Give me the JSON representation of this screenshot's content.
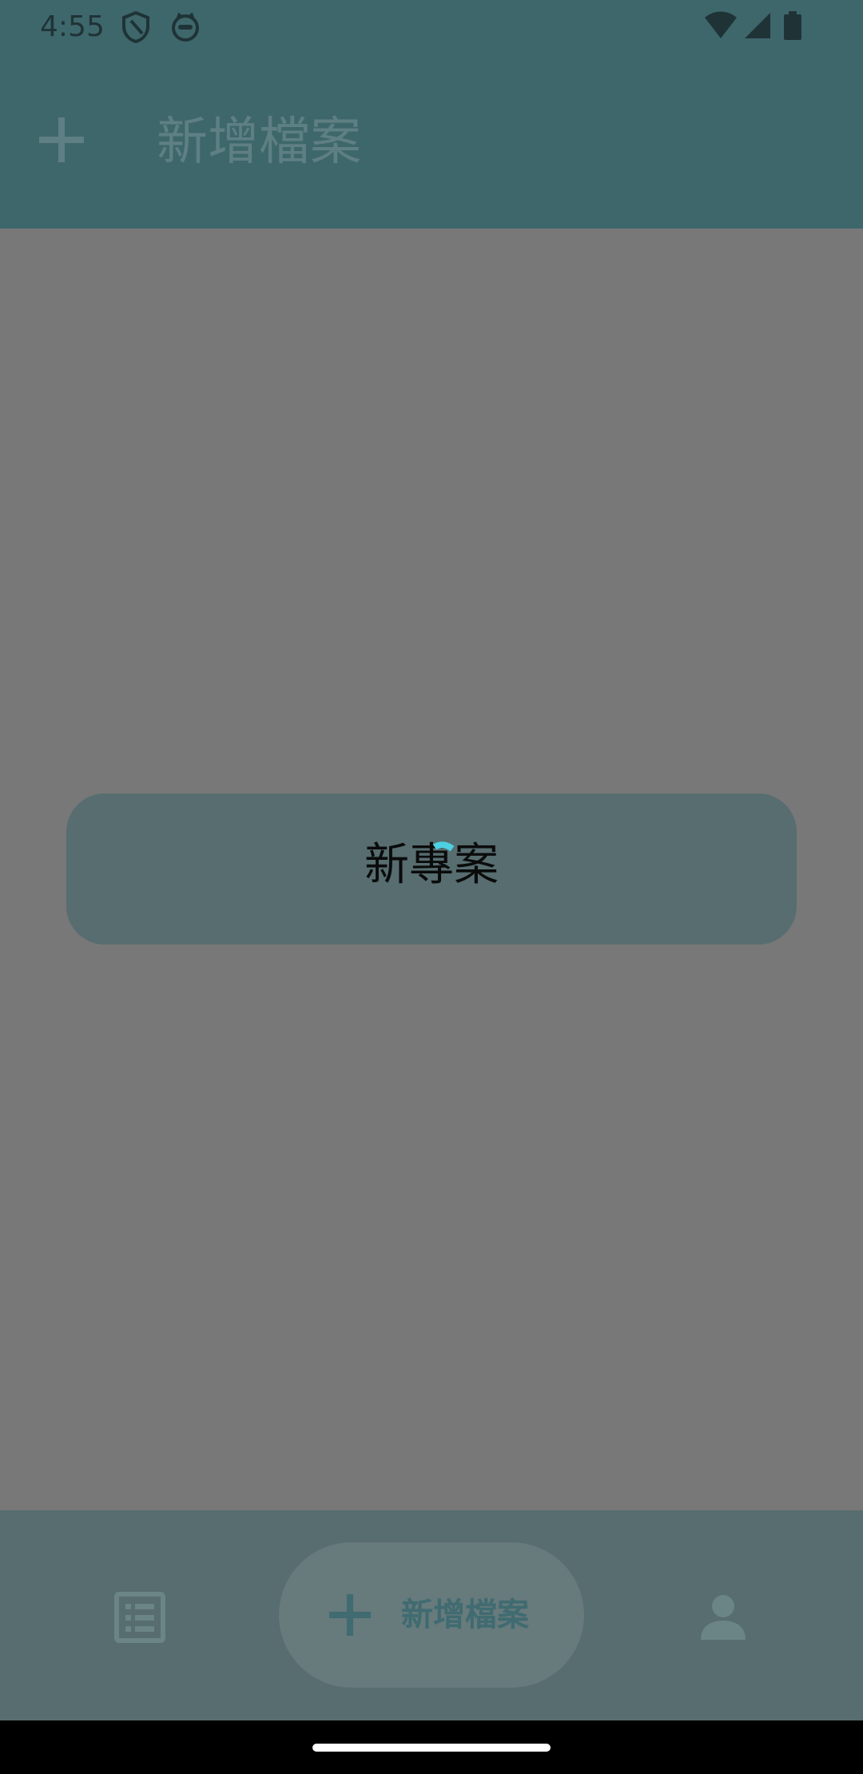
{
  "status_bar": {
    "time": "4:55",
    "icons_left": [
      "shield-icon",
      "cat-face-icon"
    ],
    "icons_right": [
      "wifi-icon",
      "signal-icon",
      "battery-icon"
    ]
  },
  "app_bar": {
    "title": "新增檔案",
    "leading_icon": "plus-icon"
  },
  "dialog": {
    "text": "新專案",
    "loading": true
  },
  "bottom_nav": {
    "items": [
      {
        "icon": "list-icon"
      },
      {
        "icon": "plus-icon",
        "label": "新增檔案",
        "selected": true
      },
      {
        "icon": "profile-icon"
      }
    ]
  },
  "colors": {
    "app_bar": "#3e676c",
    "scrim": "#787878",
    "dialog": "#576d70",
    "accent": "#4dd0e1"
  }
}
